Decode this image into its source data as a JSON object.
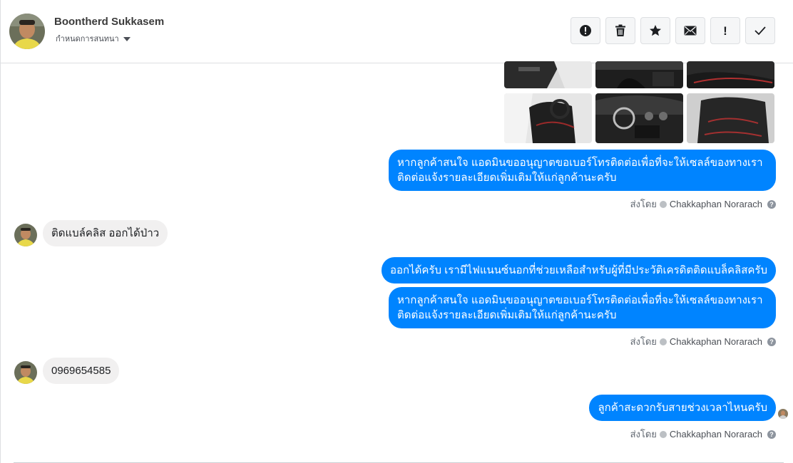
{
  "header": {
    "contact_name": "Boontherd Sukkasem",
    "status_label": "กำหนดการสนทนา"
  },
  "toolbar": {
    "buttons": [
      {
        "name": "report-icon",
        "tooltip": "report"
      },
      {
        "name": "trash-icon",
        "tooltip": "delete"
      },
      {
        "name": "star-icon",
        "tooltip": "star"
      },
      {
        "name": "envelope-icon",
        "tooltip": "mark unread"
      },
      {
        "name": "exclamation-icon",
        "glyph": "!"
      },
      {
        "name": "checkmark-icon",
        "tooltip": "done"
      }
    ]
  },
  "messages": [
    {
      "type": "photos",
      "count": 6
    },
    {
      "type": "outgoing",
      "text": "หากลูกค้าสนใจ แอดมินขออนุญาตขอเบอร์โทรติดต่อเพื่อที่จะให้เซลล์ของทางเรา\nติดต่อแจ้งรายละเอียดเพิ่มเติมให้แก่ลูกค้านะครับ"
    },
    {
      "type": "incoming",
      "text": "ติดแบล์คลิส ออกได้ป่าว"
    },
    {
      "type": "outgoing",
      "text": "ออกได้ครับ เรามีไฟแนนซ์นอกที่ช่วยเหลือสำหรับผู้ที่มีประวัติเครดิตติดแบล็คลิสครับ"
    },
    {
      "type": "outgoing",
      "text": "หากลูกค้าสนใจ แอดมินขออนุญาตขอเบอร์โทรติดต่อเพื่อที่จะให้เซลล์ของทางเรา\nติดต่อแจ้งรายละเอียดเพิ่มเติมให้แก่ลูกค้านะครับ"
    },
    {
      "type": "incoming",
      "text": "0969654585"
    },
    {
      "type": "outgoing",
      "text": "ลูกค้าสะดวกรับสายช่วงเวลาไหนครับ"
    }
  ],
  "sent_by": {
    "prefix": "ส่งโดย",
    "agent": "Chakkaphan Norarach",
    "help": "?"
  },
  "colors": {
    "outgoing_bubble": "#0084ff",
    "incoming_bubble": "#f1f0f0"
  }
}
